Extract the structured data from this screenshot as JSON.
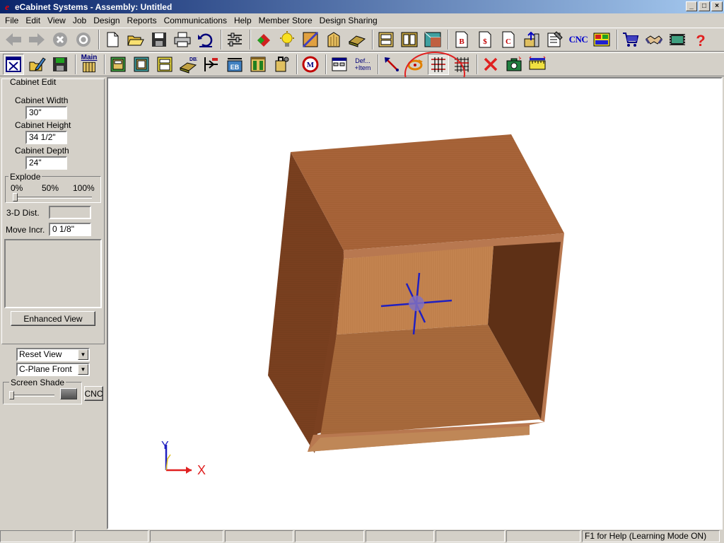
{
  "window": {
    "title": "eCabinet Systems - Assembly: Untitled",
    "app_logo": "e",
    "minimize": "_",
    "maximize": "□",
    "close": "×"
  },
  "menu": [
    "File",
    "Edit",
    "View",
    "Job",
    "Design",
    "Reports",
    "Communications",
    "Help",
    "Member Store",
    "Design Sharing"
  ],
  "toolbar1": {
    "cnc_label": "CNC"
  },
  "toolbar2": {
    "main_label": "Main",
    "dbx_label": "DBX",
    "eb_label": "EB",
    "def_label": "Def...",
    "item_label": "+Item"
  },
  "left_panel": {
    "cabinet_edit": {
      "title": "Cabinet Edit",
      "width_label": "Cabinet Width",
      "width_value": "30\"",
      "height_label": "Cabinet Height",
      "height_value": "34 1/2\"",
      "depth_label": "Cabinet Depth",
      "depth_value": "24\""
    },
    "explode": {
      "title": "Explode",
      "tick_0": "0%",
      "tick_50": "50%",
      "tick_100": "100%",
      "value_percent": 0
    },
    "dist_label": "3-D Dist.",
    "dist_value": "",
    "move_label": "Move Incr.",
    "move_value": "0 1/8\"",
    "enhanced_view_label": "Enhanced View",
    "reset_view": "Reset View",
    "cplane": "C-Plane Front",
    "screen_shade": {
      "title": "Screen Shade",
      "value_percent": 0,
      "cnc_button": "CNC"
    }
  },
  "viewport": {
    "axis_x": "X",
    "axis_y": "Y",
    "colors": {
      "wood_top": "#a8643a",
      "wood_side": "#7a4020",
      "wood_back": "#c88a58",
      "axis_blue": "#2020d0",
      "axis_red": "#e02020"
    }
  },
  "statusbar": {
    "help_text": "F1 for Help (Learning Mode ON)"
  }
}
